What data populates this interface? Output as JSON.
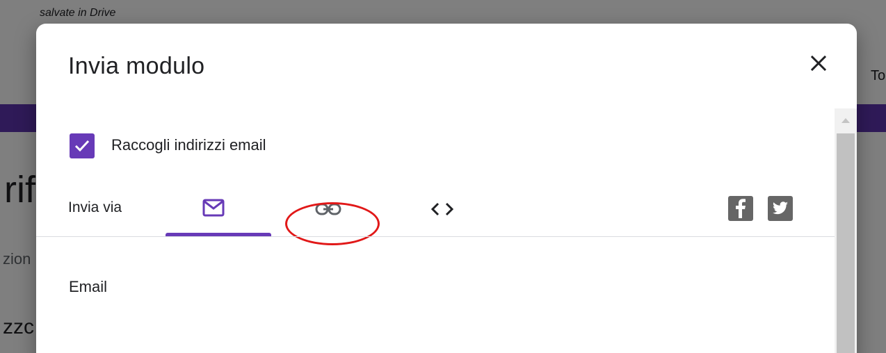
{
  "background": {
    "drive_note": "salvate in Drive",
    "title_fragment": "rif",
    "description_fragment": "zion",
    "question_fragment": "zzc",
    "right_fragment": "To",
    "accent_color": "#5e35b1"
  },
  "dialog": {
    "title": "Invia modulo",
    "close_icon": "close-icon",
    "collect_emails": {
      "label": "Raccogli indirizzi email",
      "checked": true,
      "color": "#673ab7"
    },
    "send_via": {
      "label": "Invia via",
      "tabs": [
        {
          "name": "email",
          "icon": "envelope-icon",
          "selected": true
        },
        {
          "name": "link",
          "icon": "link-icon",
          "selected": false
        },
        {
          "name": "embed",
          "icon": "embed-code-icon",
          "selected": false
        }
      ],
      "social": [
        {
          "name": "facebook",
          "icon": "facebook-icon"
        },
        {
          "name": "twitter",
          "icon": "twitter-icon"
        }
      ]
    },
    "email_section_label": "Email",
    "highlight_color": "#e11818"
  }
}
